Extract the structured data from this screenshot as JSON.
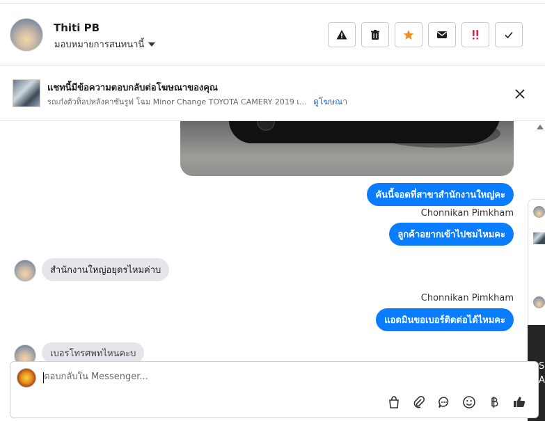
{
  "header": {
    "user_name": "Thiti PB",
    "assign_label": "มอบหมายการสนทนานี้",
    "actions": [
      "warning-icon",
      "trash-icon",
      "star-icon",
      "envelope-icon",
      "double-exclamation-icon",
      "checkmark-icon"
    ]
  },
  "ad": {
    "title": "แชทนี้มีข้อความตอบกลับต่อโฆษณาของคุณ",
    "subtitle": "รถเก๋งตัวท็อปหลังคาซันรูฟ โฉม Minor Change TOYOTA CAMERY 2019 เ...",
    "link": "ดูโฆษณา"
  },
  "messages": {
    "m1": "คันนี้จอดที่สาขาสำนักงานใหญ่คะ",
    "sender1": "Chonnikan Pimkham",
    "m2": "ลูกค้าอยากเข้าไปชมไหมคะ",
    "m3": "สำนักงานใหญ่อยุดรไหมค่าบ",
    "sender2": "Chonnikan Pimkham",
    "m4": "แอดมินขอเบอร์ติดต่อได้ไหมคะ",
    "m5_partial": "เบอรโทรศพทไหนคะบ"
  },
  "composer": {
    "placeholder": "ตอบกลับใน Messenger..."
  },
  "side_panel": {
    "line1": "S",
    "line2": "A"
  },
  "colors": {
    "accent": "#0a7cff",
    "star": "#f08a24",
    "alert": "#e41e3f",
    "link": "#216fdb"
  }
}
